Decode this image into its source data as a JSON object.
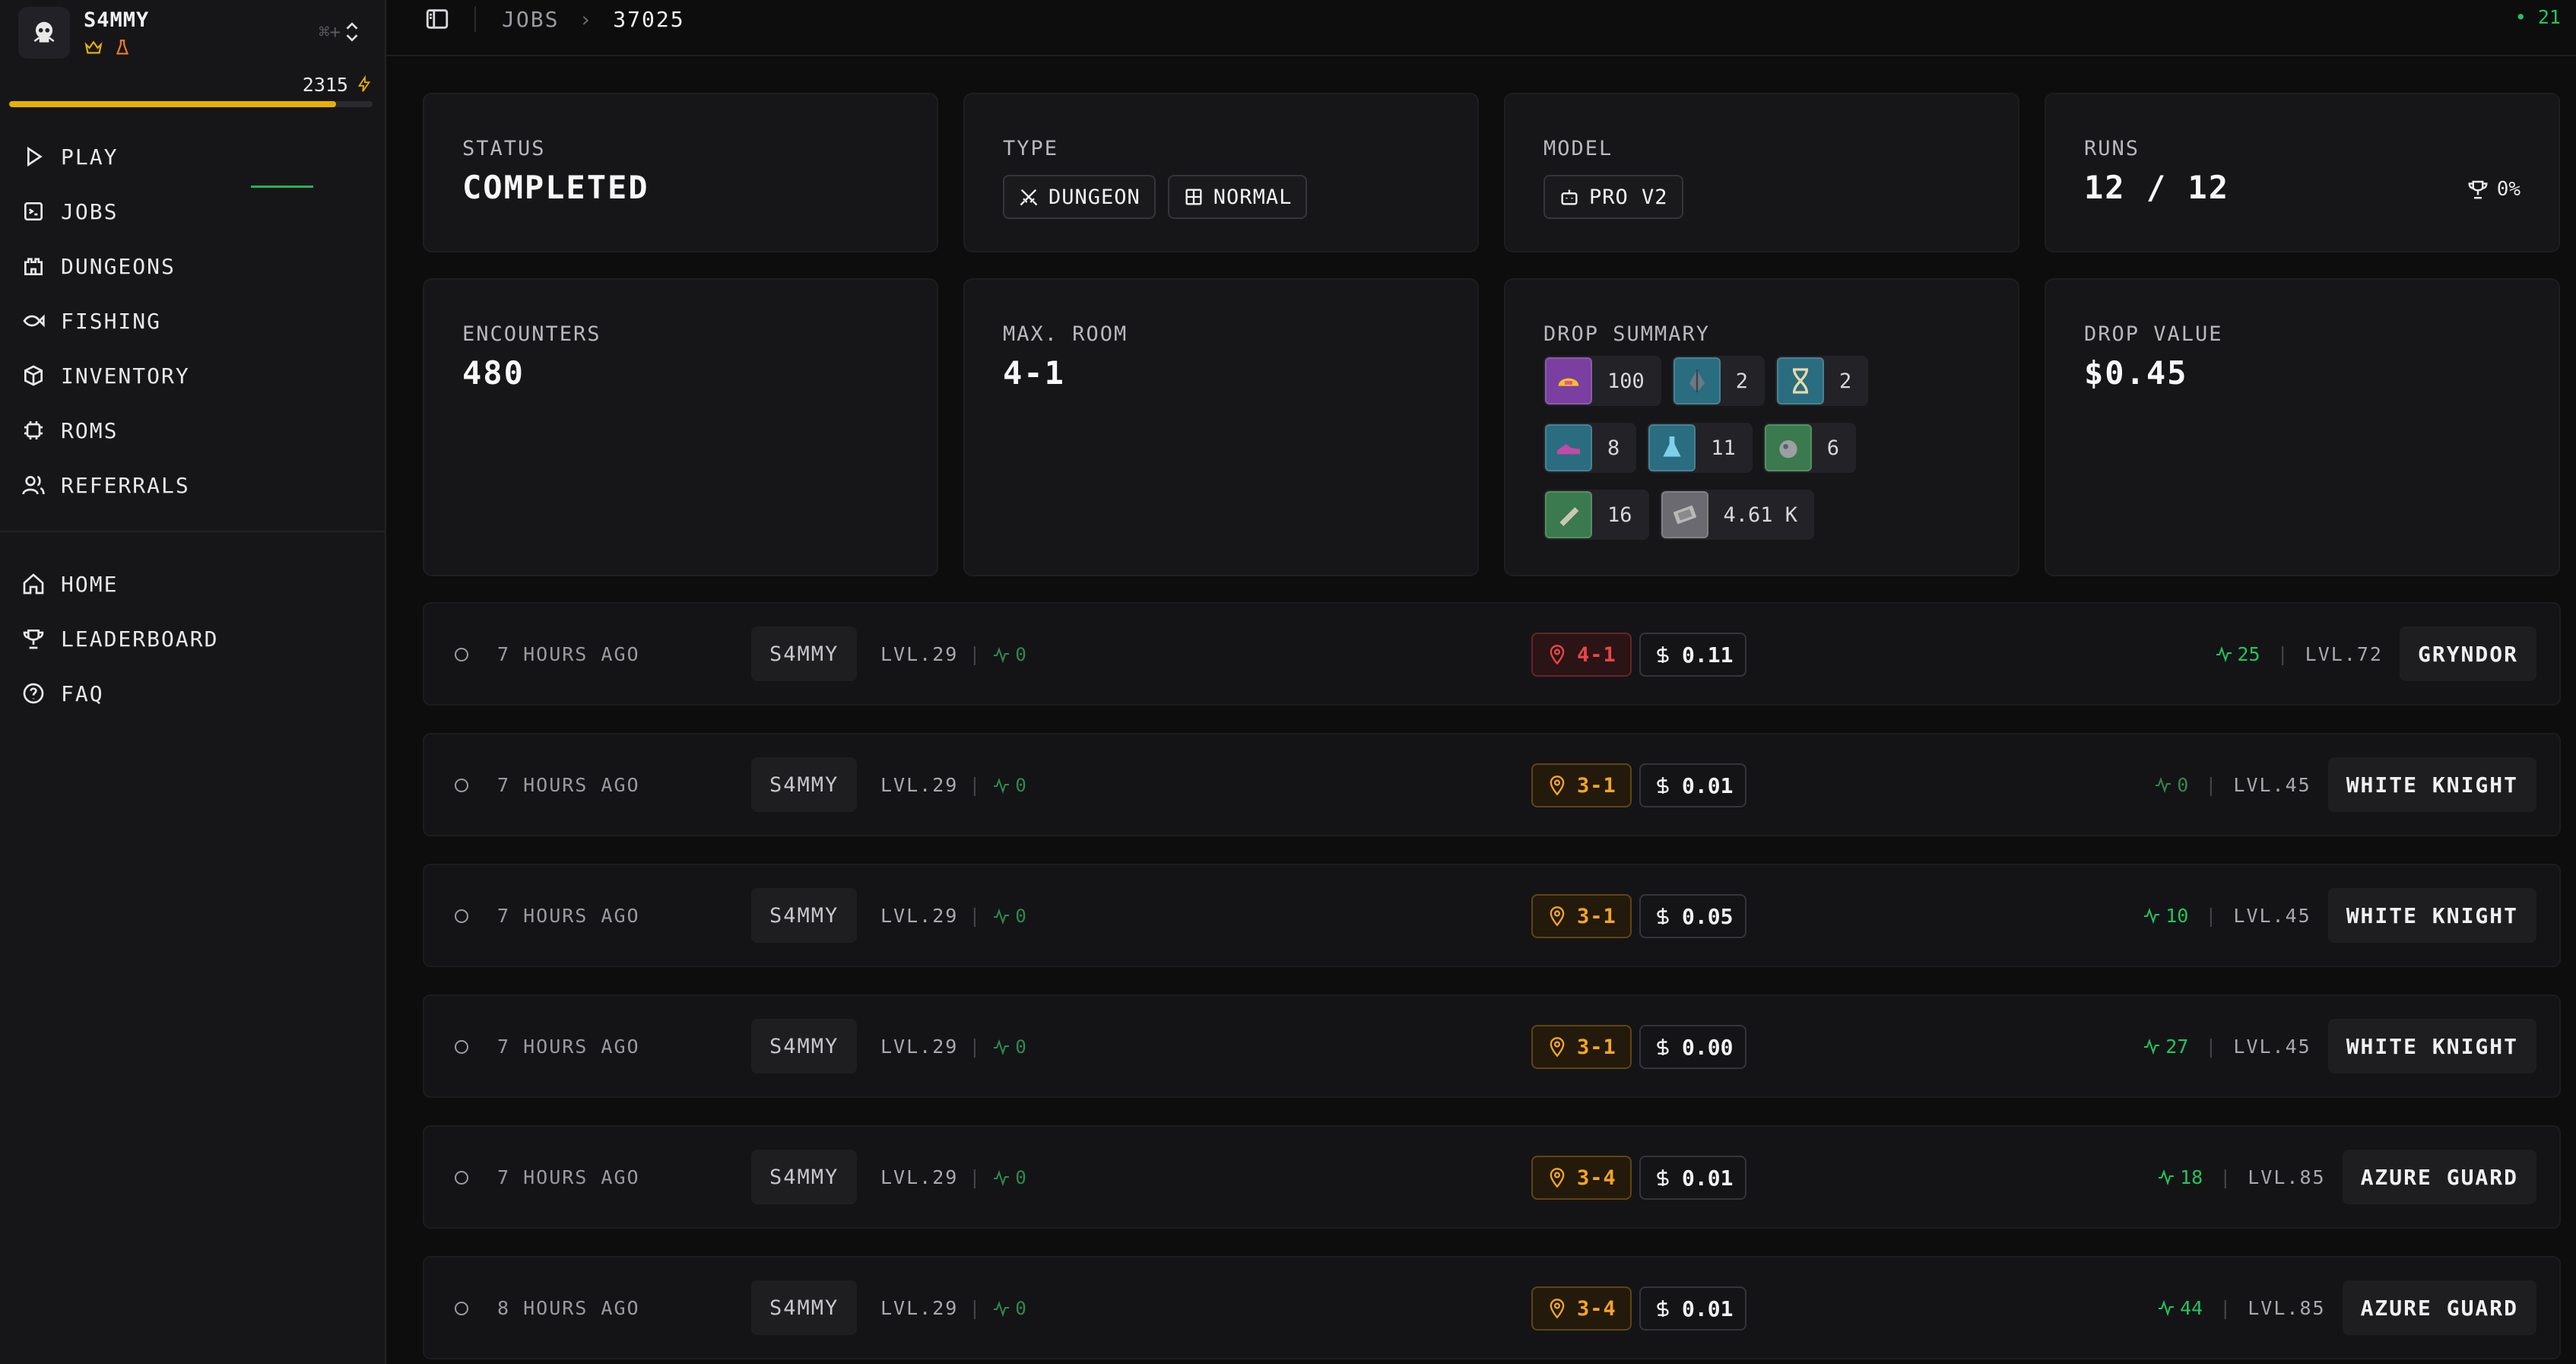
{
  "user": {
    "name": "S4MMY",
    "shortcut": "⌘+",
    "xp_value": "2315",
    "xp_progress": 0.9
  },
  "nav_main": [
    {
      "label": "PLAY",
      "icon": "play-icon"
    },
    {
      "label": "JOBS",
      "icon": "jobs-icon"
    },
    {
      "label": "DUNGEONS",
      "icon": "castle-icon"
    },
    {
      "label": "FISHING",
      "icon": "fish-icon"
    },
    {
      "label": "INVENTORY",
      "icon": "box-icon"
    },
    {
      "label": "ROMS",
      "icon": "chip-icon"
    },
    {
      "label": "REFERRALS",
      "icon": "users-icon"
    }
  ],
  "nav_secondary": [
    {
      "label": "HOME",
      "icon": "home-icon"
    },
    {
      "label": "LEADERBOARD",
      "icon": "trophy-icon"
    },
    {
      "label": "FAQ",
      "icon": "help-icon"
    }
  ],
  "breadcrumb": {
    "section": "JOBS",
    "current": "37025"
  },
  "online": "• 21",
  "status": {
    "label": "STATUS",
    "value": "COMPLETED"
  },
  "type": {
    "label": "TYPE",
    "tags": [
      "DUNGEON",
      "NORMAL"
    ]
  },
  "model": {
    "label": "MODEL",
    "value": "PRO V2"
  },
  "runs": {
    "label": "RUNS",
    "value": "12 / 12",
    "win_rate": "0%"
  },
  "encounters": {
    "label": "ENCOUNTERS",
    "value": "480"
  },
  "max_room": {
    "label": "MAX. ROOM",
    "value": "4-1"
  },
  "drop_summary": {
    "label": "DROP SUMMARY",
    "items": [
      {
        "icon": "helmet-icon",
        "qty": "100",
        "color": "#7a3fa0"
      },
      {
        "icon": "crystal-icon",
        "qty": "2",
        "color": "#2a6c80"
      },
      {
        "icon": "hourglass-icon",
        "qty": "2",
        "color": "#2a6c80"
      },
      {
        "icon": "shoe-icon",
        "qty": "8",
        "color": "#2a6c80"
      },
      {
        "icon": "flask-icon",
        "qty": "11",
        "color": "#2a6c80"
      },
      {
        "icon": "rock-icon",
        "qty": "6",
        "color": "#3a7a4e"
      },
      {
        "icon": "scroll-icon",
        "qty": "16",
        "color": "#3a7a4e"
      },
      {
        "icon": "coins-icon",
        "qty": "4.61 K",
        "color": "#6a6a70"
      }
    ]
  },
  "drop_value": {
    "label": "DROP VALUE",
    "value": "$0.45"
  },
  "runs_list": [
    {
      "time": "7 HOURS AGO",
      "player": "S4MMY",
      "level": "LVL.29",
      "player_score": "0",
      "room": "4-1",
      "room_status": "red",
      "value": "0.11",
      "enemy_score": "25",
      "enemy_level": "LVL.72",
      "enemy": "GRYNDOR",
      "enemy_live": true
    },
    {
      "time": "7 HOURS AGO",
      "player": "S4MMY",
      "level": "LVL.29",
      "player_score": "0",
      "room": "3-1",
      "room_status": "amber",
      "value": "0.01",
      "enemy_score": "0",
      "enemy_level": "LVL.45",
      "enemy": "WHITE KNIGHT",
      "enemy_live": false
    },
    {
      "time": "7 HOURS AGO",
      "player": "S4MMY",
      "level": "LVL.29",
      "player_score": "0",
      "room": "3-1",
      "room_status": "amber",
      "value": "0.05",
      "enemy_score": "10",
      "enemy_level": "LVL.45",
      "enemy": "WHITE KNIGHT",
      "enemy_live": true
    },
    {
      "time": "7 HOURS AGO",
      "player": "S4MMY",
      "level": "LVL.29",
      "player_score": "0",
      "room": "3-1",
      "room_status": "amber",
      "value": "0.00",
      "enemy_score": "27",
      "enemy_level": "LVL.45",
      "enemy": "WHITE KNIGHT",
      "enemy_live": true
    },
    {
      "time": "7 HOURS AGO",
      "player": "S4MMY",
      "level": "LVL.29",
      "player_score": "0",
      "room": "3-4",
      "room_status": "amber",
      "value": "0.01",
      "enemy_score": "18",
      "enemy_level": "LVL.85",
      "enemy": "AZURE GUARD",
      "enemy_live": true
    },
    {
      "time": "8 HOURS AGO",
      "player": "S4MMY",
      "level": "LVL.29",
      "player_score": "0",
      "room": "3-4",
      "room_status": "amber",
      "value": "0.01",
      "enemy_score": "44",
      "enemy_level": "LVL.85",
      "enemy": "AZURE GUARD",
      "enemy_live": true
    }
  ]
}
